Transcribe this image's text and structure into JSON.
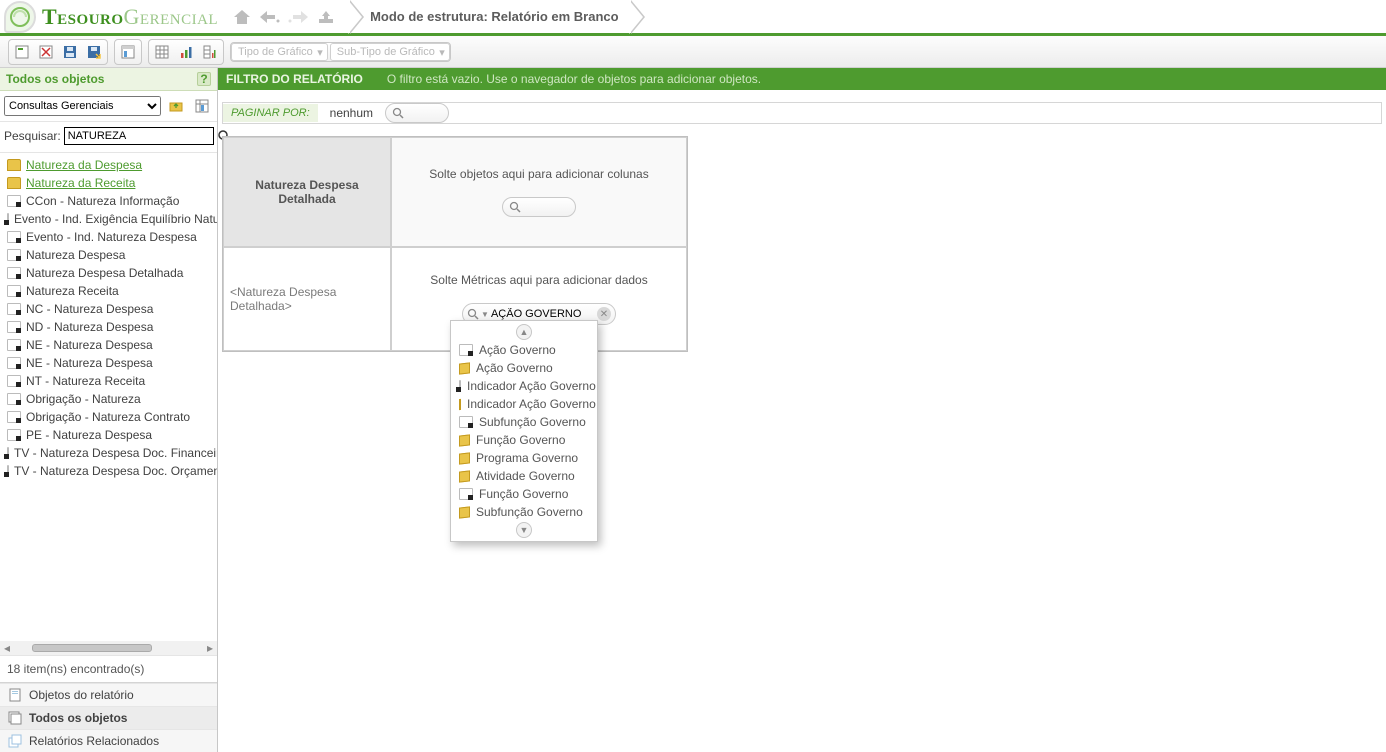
{
  "app": {
    "name_a": "Tesouro",
    "name_b": "Gerencial"
  },
  "breadcrumb": "Modo de estrutura: Relatório em Branco",
  "toolbar": {
    "chart_type": "Tipo de Gráfico",
    "chart_subtype": "Sub-Tipo de Gráfico"
  },
  "sidebar": {
    "title": "Todos os objetos",
    "scope_selected": "Consultas Gerenciais",
    "search_label": "Pesquisar:",
    "search_value": "NATUREZA",
    "items": [
      {
        "type": "folder",
        "label": "Natureza da Despesa"
      },
      {
        "type": "folder",
        "label": "Natureza da Receita"
      },
      {
        "type": "attr",
        "label": "CCon - Natureza Informação"
      },
      {
        "type": "attr",
        "label": "Evento - Ind. Exigência Equilíbrio Natu"
      },
      {
        "type": "attr",
        "label": "Evento - Ind. Natureza Despesa"
      },
      {
        "type": "attr",
        "label": "Natureza Despesa"
      },
      {
        "type": "attr",
        "label": "Natureza Despesa Detalhada"
      },
      {
        "type": "attr",
        "label": "Natureza Receita"
      },
      {
        "type": "attr",
        "label": "NC - Natureza Despesa"
      },
      {
        "type": "attr",
        "label": "ND - Natureza Despesa"
      },
      {
        "type": "attr",
        "label": "NE - Natureza Despesa"
      },
      {
        "type": "attr",
        "label": "NE - Natureza Despesa"
      },
      {
        "type": "attr",
        "label": "NT - Natureza Receita"
      },
      {
        "type": "attr",
        "label": "Obrigação - Natureza"
      },
      {
        "type": "attr",
        "label": "Obrigação - Natureza Contrato"
      },
      {
        "type": "attr",
        "label": "PE - Natureza Despesa"
      },
      {
        "type": "attr",
        "label": "TV - Natureza Despesa Doc. Financeir"
      },
      {
        "type": "attr",
        "label": "TV - Natureza Despesa Doc. Orçamen"
      }
    ],
    "status": "18 item(ns) encontrado(s)",
    "tabs": {
      "report_objects": "Objetos do relatório",
      "all_objects": "Todos os objetos",
      "related_reports": "Relatórios Relacionados"
    }
  },
  "filter_bar": {
    "label": "FILTRO DO RELATÓRIO",
    "message": "O filtro está vazio. Use o navegador de objetos para adicionar objetos."
  },
  "page_bar": {
    "label": "PAGINAR POR:",
    "value": "nenhum"
  },
  "grid": {
    "rows_header": "Natureza Despesa Detalhada",
    "cols_drop": "Solte objetos aqui para adicionar colunas",
    "rows_drop": "<Natureza Despesa Detalhada>",
    "data_drop": "Solte Métricas aqui para adicionar dados",
    "data_search_value": "AÇÃO GOVERNO"
  },
  "suggest": [
    {
      "ico": "attr",
      "label": "Ação Governo"
    },
    {
      "ico": "cube",
      "label": "Ação Governo"
    },
    {
      "ico": "attr",
      "label": "Indicador Ação Governo"
    },
    {
      "ico": "cube",
      "label": "Indicador Ação Governo"
    },
    {
      "ico": "attr",
      "label": "Subfunção Governo"
    },
    {
      "ico": "cube",
      "label": "Função Governo"
    },
    {
      "ico": "cube",
      "label": "Programa Governo"
    },
    {
      "ico": "cube",
      "label": "Atividade Governo"
    },
    {
      "ico": "attr",
      "label": "Função Governo"
    },
    {
      "ico": "cube",
      "label": "Subfunção Governo"
    }
  ]
}
